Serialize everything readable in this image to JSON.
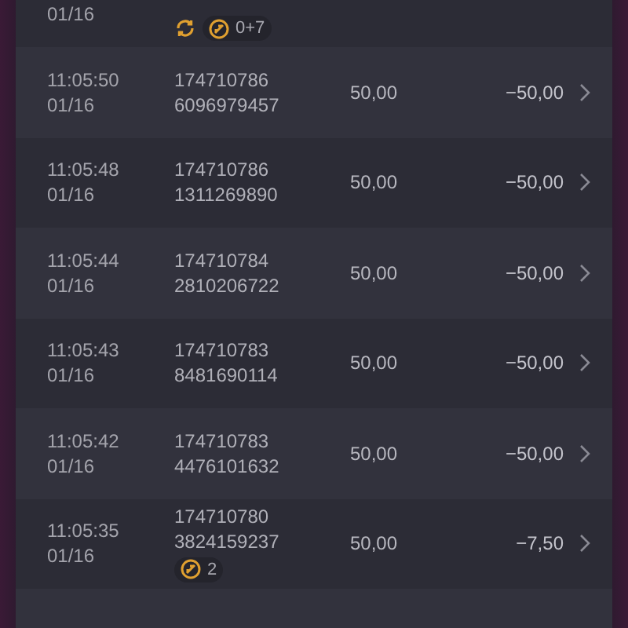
{
  "rows": [
    {
      "date": "01/16",
      "badges": [
        {
          "kind": "spin"
        },
        {
          "kind": "ball",
          "text": "0+7"
        }
      ]
    },
    {
      "time": "11:05:50",
      "date": "01/16",
      "ids": [
        "174710786",
        "6096979457"
      ],
      "stake": "50,00",
      "result": "−50,00"
    },
    {
      "time": "11:05:48",
      "date": "01/16",
      "ids": [
        "174710786",
        "1311269890"
      ],
      "stake": "50,00",
      "result": "−50,00"
    },
    {
      "time": "11:05:44",
      "date": "01/16",
      "ids": [
        "174710784",
        "2810206722"
      ],
      "stake": "50,00",
      "result": "−50,00"
    },
    {
      "time": "11:05:43",
      "date": "01/16",
      "ids": [
        "174710783",
        "8481690114"
      ],
      "stake": "50,00",
      "result": "−50,00"
    },
    {
      "time": "11:05:42",
      "date": "01/16",
      "ids": [
        "174710783",
        "4476101632"
      ],
      "stake": "50,00",
      "result": "−50,00"
    },
    {
      "time": "11:05:35",
      "date": "01/16",
      "ids": [
        "174710780",
        "3824159237"
      ],
      "stake": "50,00",
      "result": "−7,50",
      "badges": [
        {
          "kind": "ball",
          "text": "2"
        }
      ]
    }
  ]
}
